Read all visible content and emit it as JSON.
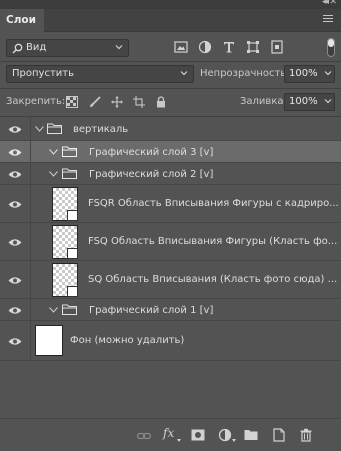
{
  "panel": {
    "tab_label": "Слои"
  },
  "filter": {
    "kind_label": "Вид"
  },
  "blend": {
    "mode": "Пропустить",
    "opacity_label": "Непрозрачность:",
    "opacity_value": "100%"
  },
  "lock": {
    "label": "Закрепить:",
    "fill_label": "Заливка:",
    "fill_value": "100%"
  },
  "layers": [
    {
      "label": "вертикаль",
      "type": "group",
      "expanded": true,
      "indent": 0,
      "selected": false
    },
    {
      "label": "Графический слой 3 [v]",
      "type": "group",
      "expanded": true,
      "indent": 1,
      "selected": true
    },
    {
      "label": "Графический слой 2 [v]",
      "type": "group",
      "expanded": true,
      "indent": 1,
      "selected": false
    },
    {
      "label": "FSQR Область Вписывания Фигуры с кадриро...",
      "type": "smart",
      "indent": 2,
      "selected": false
    },
    {
      "label": "FSQ Область Вписывания Фигуры (Класть фо...",
      "type": "smart",
      "indent": 2,
      "selected": false
    },
    {
      "label": "SQ Область Вписывания (Класть фото сюда) ...",
      "type": "smart",
      "indent": 2,
      "selected": false
    },
    {
      "label": "Графический слой 1 [v]",
      "type": "group",
      "expanded": true,
      "indent": 1,
      "selected": false
    },
    {
      "label": "Фон (можно удалить)",
      "type": "background",
      "indent": 0,
      "selected": false
    }
  ],
  "bottom": {
    "fx_label": "fx"
  },
  "colors": {
    "panel_bg": "#535353",
    "selected_row": "#6b6b6b",
    "text": "#dedede"
  }
}
